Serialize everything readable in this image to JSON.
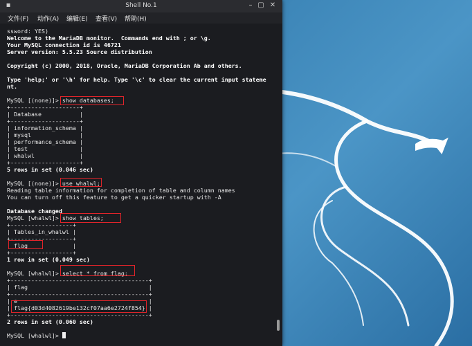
{
  "window": {
    "title": "Shell No.1",
    "minimize_icon": "minimize-icon",
    "maximize_icon": "maximize-icon",
    "close_icon": "close-icon"
  },
  "menu": [
    "文件(F)",
    "动作(A)",
    "编辑(E)",
    "查看(V)",
    "帮助(H)"
  ],
  "terminal": {
    "lines": [
      "ssword: YES)",
      "Welcome to the MariaDB monitor.  Commands end with ; or \\g.",
      "Your MySQL connection id is 46721",
      "Server version: 5.5.23 Source distribution",
      "",
      "Copyright (c) 2000, 2018, Oracle, MariaDB Corporation Ab and others.",
      "",
      "Type 'help;' or '\\h' for help. Type '\\c' to clear the current input stateme",
      "nt.",
      "",
      "MySQL [(none)]> show databases;",
      "+--------------------+",
      "| Database           |",
      "+--------------------+",
      "| information_schema |",
      "| mysql              |",
      "| performance_schema |",
      "| test               |",
      "| whalwl             |",
      "+--------------------+",
      "5 rows in set (0.046 sec)",
      "",
      "MySQL [(none)]> use whalwl;",
      "Reading table information for completion of table and column names",
      "You can turn off this feature to get a quicker startup with -A",
      "",
      "Database changed",
      "MySQL [whalwl]> show tables;",
      "+------------------+",
      "| Tables_in_whalwl |",
      "+------------------+",
      "| flag             |",
      "+------------------+",
      "1 row in set (0.049 sec)",
      "",
      "MySQL [whalwl]> select * from flag;",
      "+----------------------------------------+",
      "| flag                                   |",
      "+----------------------------------------+",
      "| e                                      |",
      "| flag{d03d4082619be132cf07aa6e2724f854} |",
      "+----------------------------------------+",
      "2 rows in set (0.060 sec)",
      "",
      "MySQL [whalwl]> "
    ],
    "bold_lines": [
      1,
      2,
      3,
      5,
      7,
      8,
      20,
      26,
      33,
      42
    ]
  },
  "highlight_color": "#e0242a",
  "desktop": {
    "logo": "kali-dragon-logo"
  }
}
